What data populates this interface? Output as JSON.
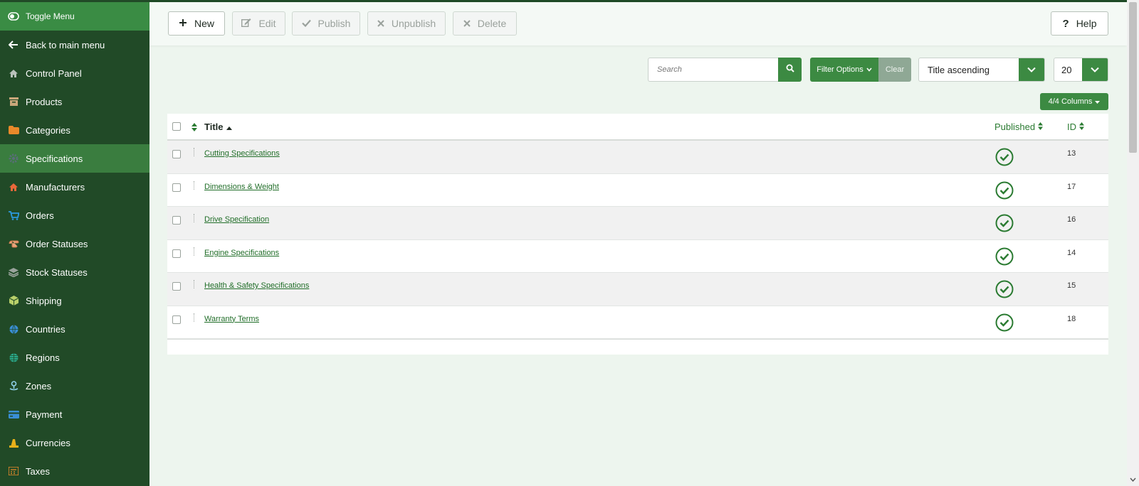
{
  "sidebar": {
    "items": [
      {
        "label": "Toggle Menu",
        "icon": "toggle-icon"
      },
      {
        "label": "Back to main menu",
        "icon": "arrow-left-icon"
      },
      {
        "label": "Control Panel",
        "icon": "home-icon"
      },
      {
        "label": "Products",
        "icon": "archive-icon"
      },
      {
        "label": "Categories",
        "icon": "folder-icon"
      },
      {
        "label": "Specifications",
        "icon": "cog-icon"
      },
      {
        "label": "Manufacturers",
        "icon": "factory-icon"
      },
      {
        "label": "Orders",
        "icon": "cart-icon"
      },
      {
        "label": "Order Statuses",
        "icon": "hand-icon"
      },
      {
        "label": "Stock Statuses",
        "icon": "layers-icon"
      },
      {
        "label": "Shipping",
        "icon": "box-icon"
      },
      {
        "label": "Countries",
        "icon": "globe-icon"
      },
      {
        "label": "Regions",
        "icon": "globe-grid-icon"
      },
      {
        "label": "Zones",
        "icon": "pin-icon"
      },
      {
        "label": "Payment",
        "icon": "credit-card-icon"
      },
      {
        "label": "Currencies",
        "icon": "coins-icon"
      },
      {
        "label": "Taxes",
        "icon": "calculator-icon"
      }
    ],
    "active": "Specifications",
    "colors": {
      "bg": "#214a27",
      "active": "#3a7d3f",
      "toggle": "#3a8c44"
    }
  },
  "toolbar": {
    "new_label": "New",
    "edit_label": "Edit",
    "publish_label": "Publish",
    "unpublish_label": "Unpublish",
    "delete_label": "Delete",
    "help_label": "Help"
  },
  "filters": {
    "search_placeholder": "Search",
    "filter_options_label": "Filter Options",
    "clear_label": "Clear",
    "ordering_value": "Title ascending",
    "limit_value": "20",
    "columns_label": "4/4 Columns"
  },
  "table": {
    "headers": {
      "title": "Title",
      "published": "Published",
      "id": "ID"
    },
    "rows": [
      {
        "title": "Cutting Specifications",
        "published": true,
        "id": "13"
      },
      {
        "title": "Dimensions & Weight",
        "published": true,
        "id": "17"
      },
      {
        "title": "Drive Specification",
        "published": true,
        "id": "16"
      },
      {
        "title": "Engine Specifications",
        "published": true,
        "id": "14"
      },
      {
        "title": "Health & Safety Specifications",
        "published": true,
        "id": "15"
      },
      {
        "title": "Warranty Terms",
        "published": true,
        "id": "18"
      }
    ]
  },
  "colors": {
    "accent": "#3c8a42",
    "link": "#216e29",
    "page_bg": "#edf5ee"
  }
}
